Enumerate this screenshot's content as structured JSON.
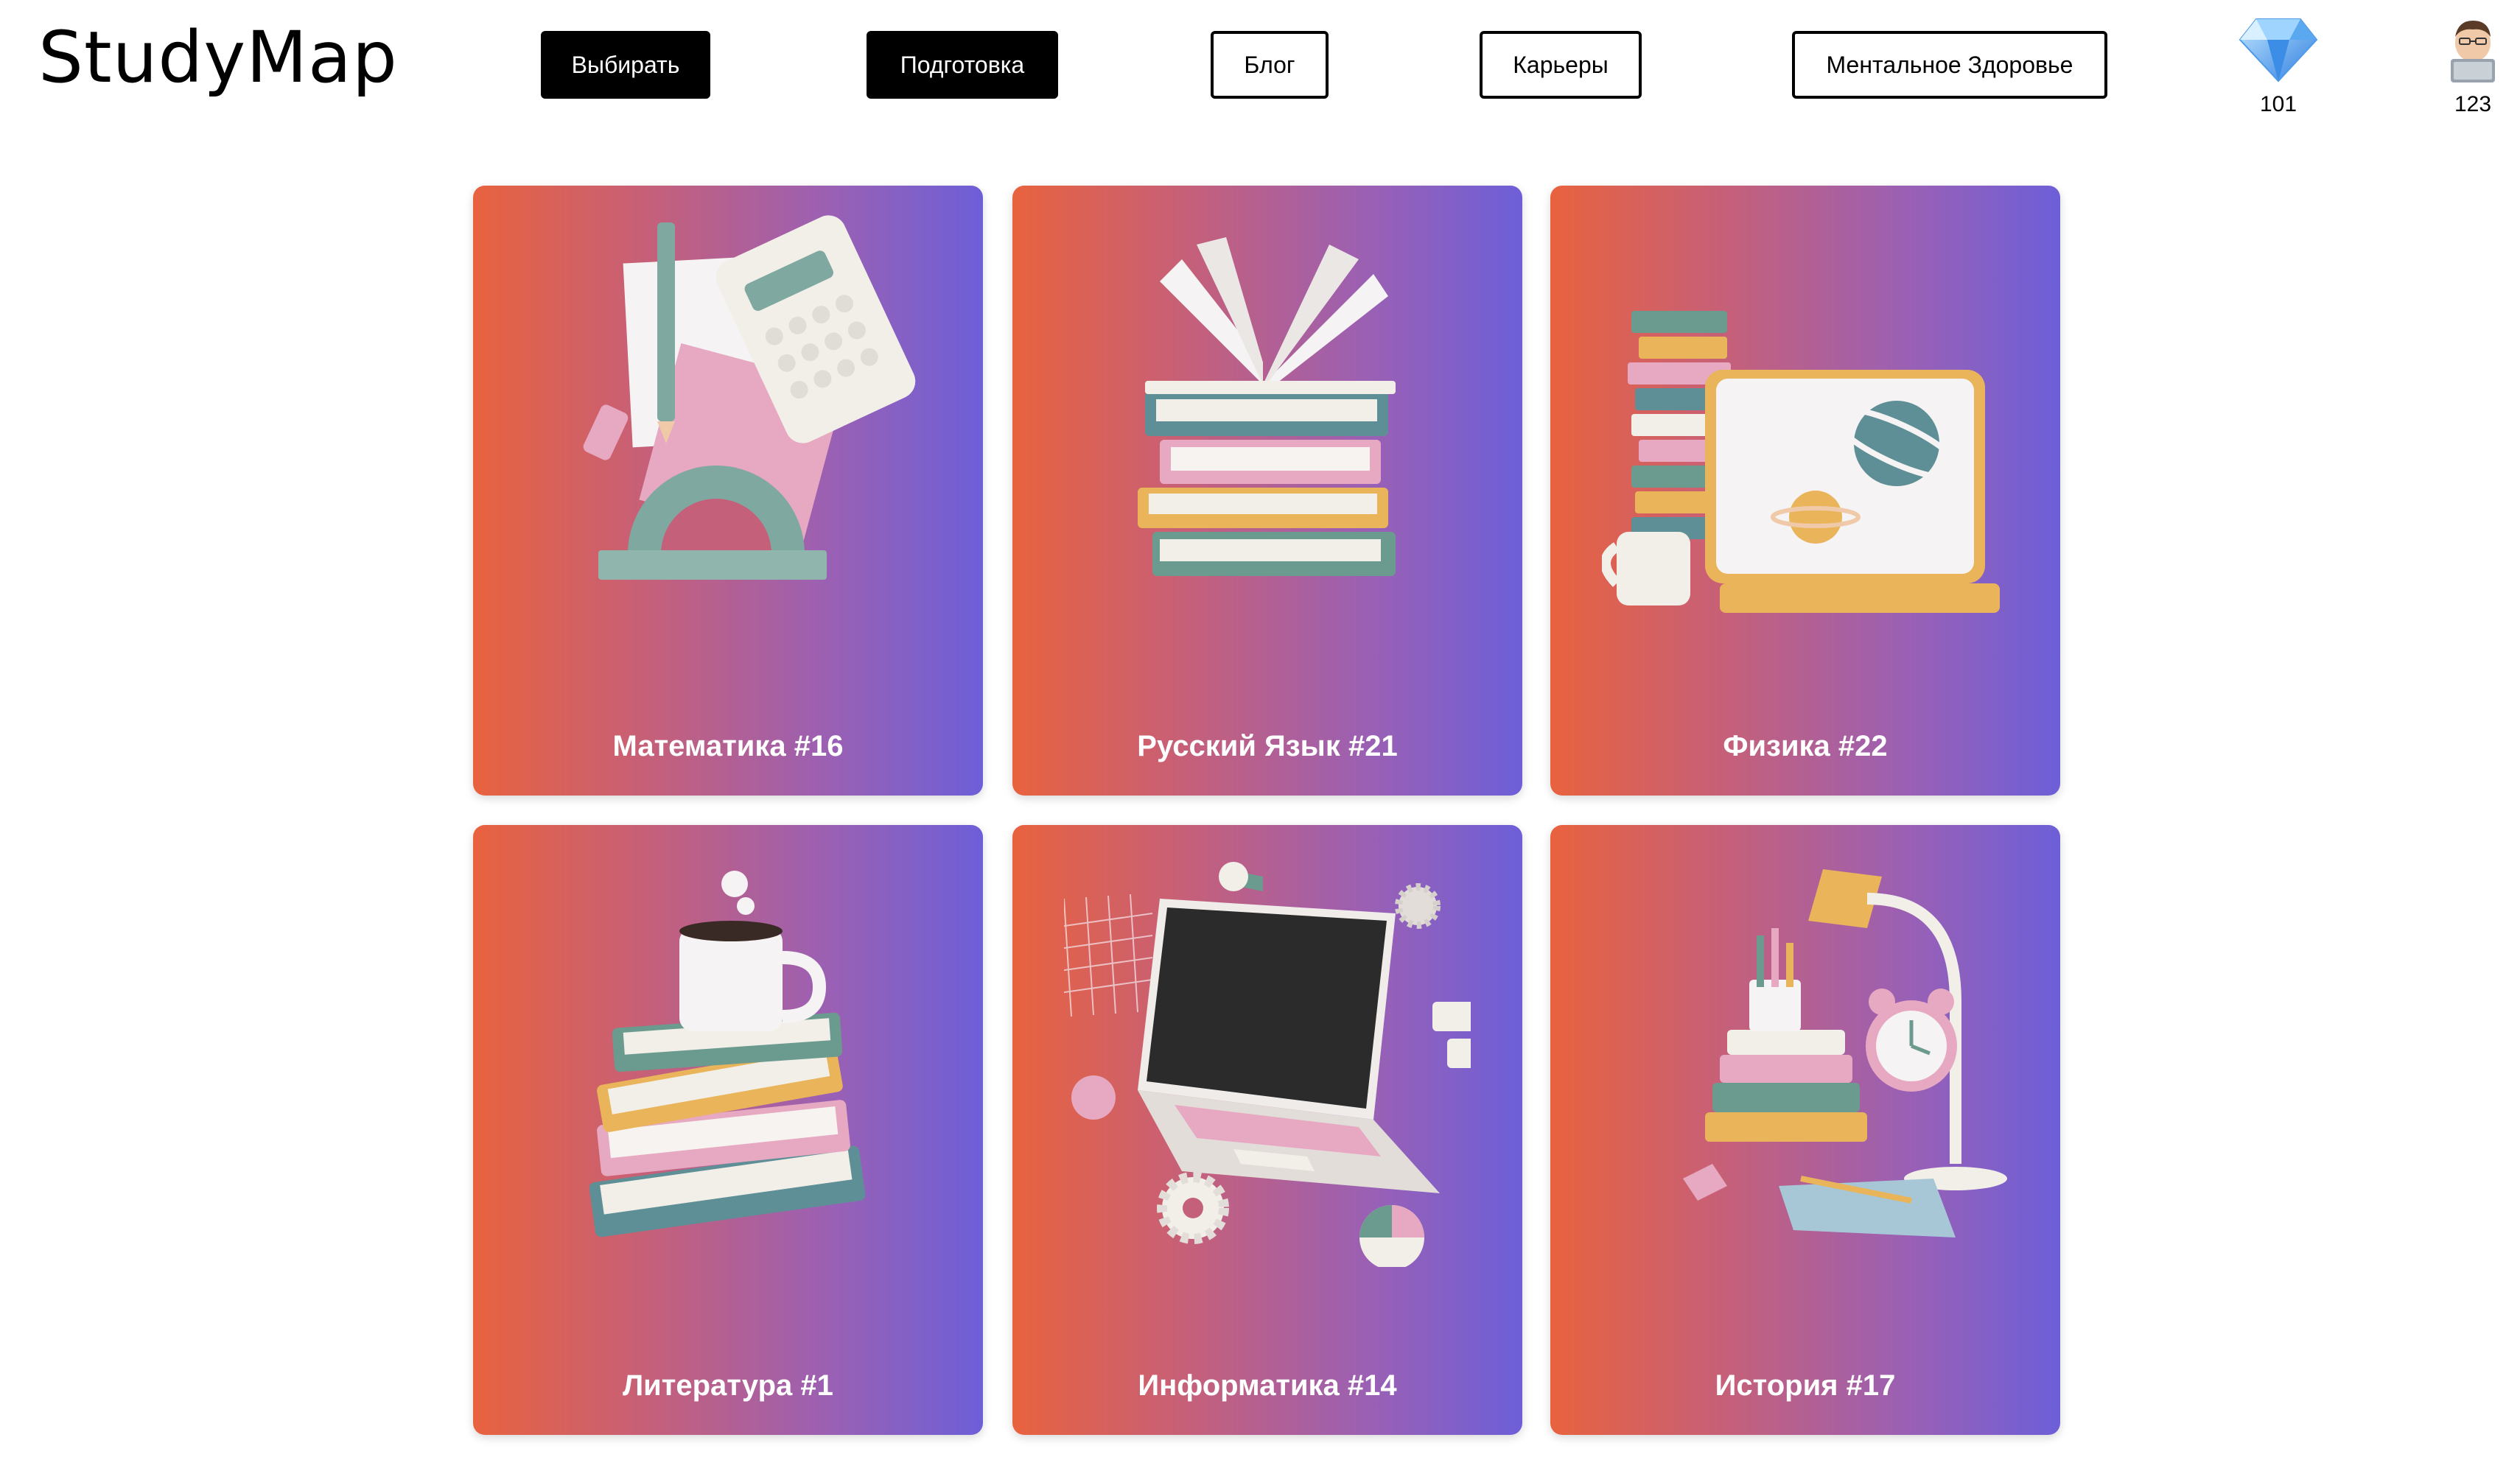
{
  "header": {
    "logo": "StudyMap",
    "nav": [
      {
        "label": "Выбирать",
        "style": "filled"
      },
      {
        "label": "Подготовка",
        "style": "filled"
      },
      {
        "label": "Блог",
        "style": "outline"
      },
      {
        "label": "Карьеры",
        "style": "outline"
      },
      {
        "label": "Ментальное Здоровье",
        "style": "outline"
      }
    ],
    "gems": {
      "icon": "diamond-icon",
      "value": "101"
    },
    "user": {
      "icon": "avatar-icon",
      "value": "123"
    }
  },
  "cards": [
    {
      "title": "Математика #16",
      "icon": "math-supplies-illustration"
    },
    {
      "title": "Русский Язык #21",
      "icon": "book-stack-open-illustration"
    },
    {
      "title": "Физика #22",
      "icon": "planets-laptop-illustration"
    },
    {
      "title": "Литература #1",
      "icon": "books-mug-illustration"
    },
    {
      "title": "Информатика #14",
      "icon": "laptop-gears-illustration"
    },
    {
      "title": "История #17",
      "icon": "desk-lamp-clock-illustration"
    }
  ],
  "colors": {
    "gradient_start": "#e8623e",
    "gradient_end": "#6d5fd8",
    "teal": "#7fa8a0",
    "pink": "#e7a9c2",
    "cream": "#f2efe9",
    "mustard": "#e9b45a"
  }
}
